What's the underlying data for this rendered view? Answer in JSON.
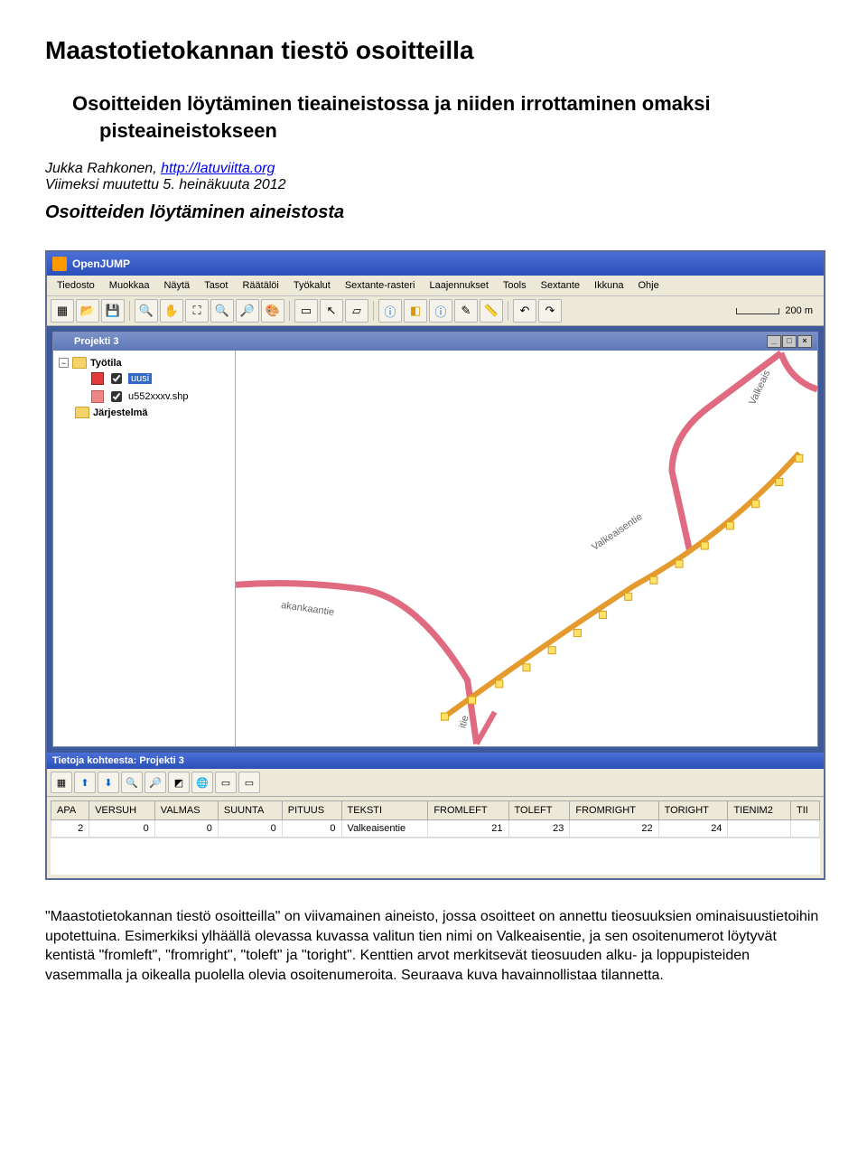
{
  "doc": {
    "h1": "Maastotietokannan tiestö osoitteilla",
    "h2_line1": "Osoitteiden löytäminen tieaineistossa ja niiden irrottaminen omaksi",
    "h2_line2": "pisteaineistokseen",
    "author_prefix": "Jukka Rahkonen, ",
    "author_link_text": "http://latuviitta.org",
    "modified": "Viimeksi muutettu 5. heinäkuuta 2012",
    "h3": "Osoitteiden löytäminen aineistosta",
    "body": "\"Maastotietokannan tiestö osoitteilla\" on viivamainen aineisto, jossa osoitteet on annettu tieosuuksien ominaisuustietoihin upotettuina. Esimerkiksi ylhäällä olevassa kuvassa valitun tien nimi on Valkeaisentie, ja sen osoitenumerot löytyvät kentistä \"fromleft\", \"fromright\", \"toleft\" ja \"toright\". Kenttien arvot merkitsevät tieosuuden alku- ja loppupisteiden vasemmalla ja oikealla puolella olevia osoitenumeroita. Seuraava kuva havainnollistaa tilannetta."
  },
  "app": {
    "title": "OpenJUMP",
    "menus": [
      "Tiedosto",
      "Muokkaa",
      "Näytä",
      "Tasot",
      "Räätälöi",
      "Työkalut",
      "Sextante-rasteri",
      "Laajennukset",
      "Tools",
      "Sextante",
      "Ikkuna",
      "Ohje"
    ],
    "scale_label": "200 m",
    "project_title": "Projekti 3",
    "tree": {
      "root": "Työtila",
      "layer1": "uusi",
      "layer2": "u552xxxv.shp",
      "system": "Järjestelmä"
    },
    "map": {
      "label1": "Valkeaisentie",
      "label2": "akankaantie",
      "label3": "itie",
      "label4": "Valkeais"
    },
    "attr": {
      "title": "Tietoja kohteesta: Projekti 3",
      "headers": [
        "APA",
        "VERSUH",
        "VALMAS",
        "SUUNTA",
        "PITUUS",
        "TEKSTI",
        "FROMLEFT",
        "TOLEFT",
        "FROMRIGHT",
        "TORIGHT",
        "TIENIM2",
        "TII"
      ],
      "row": [
        "2",
        "0",
        "0",
        "0",
        "0",
        "Valkeaisentie",
        "21",
        "23",
        "22",
        "24",
        "",
        ""
      ]
    }
  }
}
